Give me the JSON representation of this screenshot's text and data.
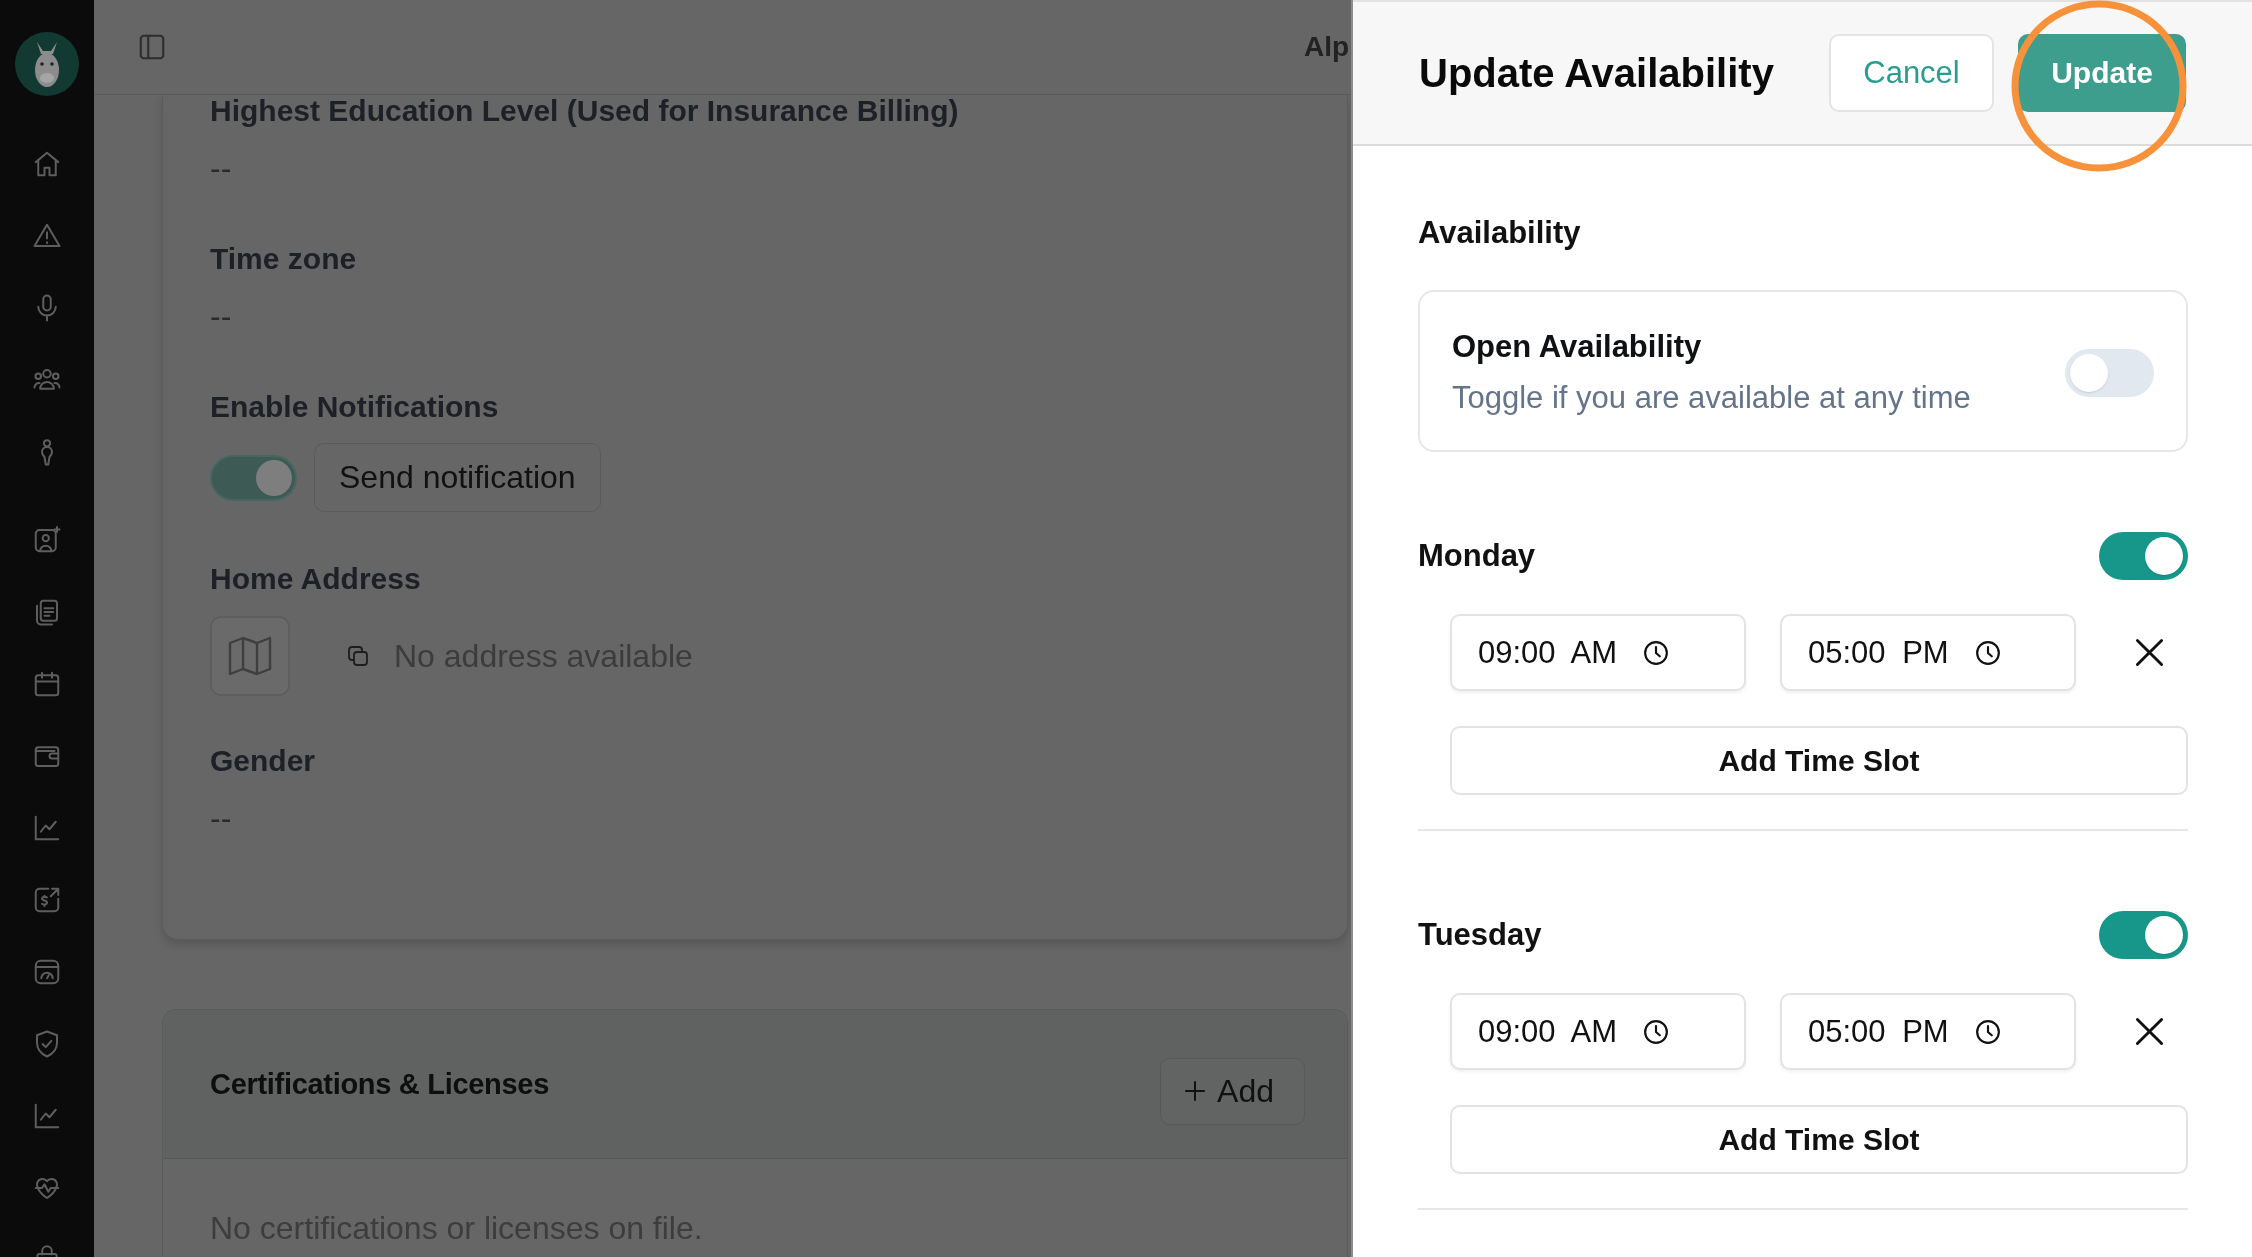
{
  "top_bar": {
    "title": "Alp"
  },
  "profile_card": {
    "fields": [
      {
        "kind": "text",
        "label": "Highest Education Level (Used for Insurance Billing)",
        "value": "--"
      },
      {
        "kind": "text",
        "label": "Time zone",
        "value": "--"
      },
      {
        "kind": "toggle",
        "label": "Enable Notifications",
        "on": true,
        "button": "Send notification"
      },
      {
        "kind": "address",
        "label": "Home Address",
        "value": "No address available"
      },
      {
        "kind": "text",
        "label": "Gender",
        "value": "--"
      }
    ]
  },
  "certifications": {
    "title": "Certifications & Licenses",
    "add_button": "Add",
    "empty_text": "No certifications or licenses on file."
  },
  "drawer": {
    "title": "Update Availability",
    "cancel_button": "Cancel",
    "update_button": {
      "label": "Update",
      "highlighted": true
    },
    "section_label": "Availability",
    "open_availability": {
      "title": "Open Availability",
      "description": "Toggle if you are available at any time",
      "on": false
    },
    "days": [
      {
        "name": "Monday",
        "on": true,
        "slots": [
          {
            "start": "09:00 AM",
            "end": "05:00 PM"
          }
        ],
        "add_button": "Add Time Slot"
      },
      {
        "name": "Tuesday",
        "on": true,
        "slots": [
          {
            "start": "09:00 AM",
            "end": "05:00 PM"
          }
        ],
        "add_button": "Add Time Slot"
      }
    ]
  }
}
